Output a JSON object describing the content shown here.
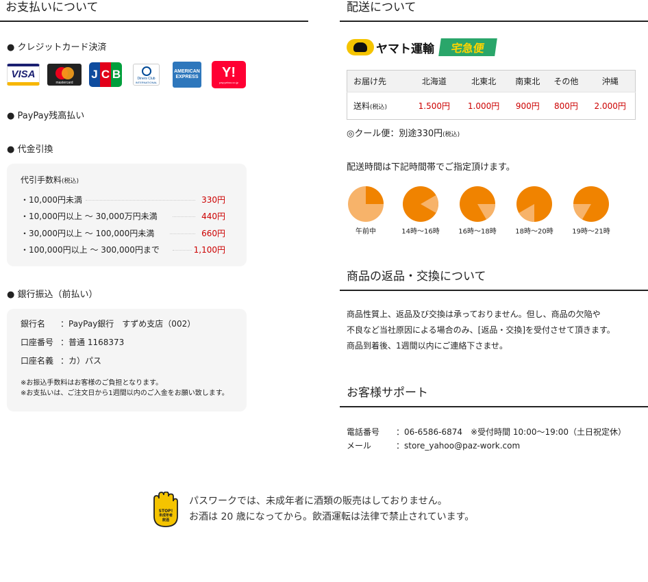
{
  "payment": {
    "title": "お支払いについて",
    "credit_card": "● クレジットカード決済",
    "cards": {
      "visa": "VISA",
      "mastercard": "mastercard",
      "jcb": [
        "J",
        "C",
        "B"
      ],
      "diners": "Diners Club",
      "diners_sub": "INTERNATIONAL",
      "amex_1": "AMERICAN",
      "amex_2": "EXPRESS",
      "yahoo": "Y!",
      "yahoo_sub": "pay.yahoo.co.jp"
    },
    "paypay": "● PayPay残高払い",
    "cod": "● 代金引換",
    "cod_fee_title": "代引手数料",
    "cod_fee_tax": "(税込)",
    "cod_fees": [
      {
        "label": "・10,000円未満",
        "amount": "330円"
      },
      {
        "label": "・10,000円以上 ～ 30,000万円未満",
        "amount": "440円"
      },
      {
        "label": "・30,000円以上 ～ 100,000円未満",
        "amount": "660円"
      },
      {
        "label": "・100,000円以上 ～ 300,000円まで",
        "amount": "1,100円"
      }
    ],
    "bank": "● 銀行振込（前払い）",
    "bank_rows": [
      {
        "label": "銀行名",
        "value": "：PayPay銀行　すずめ支店（002）"
      },
      {
        "label": "口座番号",
        "value": "：普通  1168373"
      },
      {
        "label": "口座名義",
        "value": "：カ）パス"
      }
    ],
    "bank_notes": [
      "※お振込手数料はお客様のご負担となります。",
      "※お支払いは、ご注文日から1週間以内のご入金をお願い致します。"
    ]
  },
  "shipping": {
    "title": "配送について",
    "carrier": "ヤマト運輸",
    "service": "宅急便",
    "table_headers": [
      "お届け先",
      "北海道",
      "北東北",
      "南東北",
      "その他",
      "沖縄"
    ],
    "row_label": "送料",
    "row_label_tax": "(税込)",
    "row_values": [
      "1.500円",
      "1.000円",
      "900円",
      "800円",
      "2.000円"
    ],
    "cool": "◎クール便：別途330円",
    "cool_tax": "(税込)",
    "time_note": "配送時間は下記時間帯でご指定頂けます。",
    "time_slots": [
      "午前中",
      "14時～16時",
      "16時～18時",
      "18時～20時",
      "19時～21時"
    ]
  },
  "returns": {
    "title": "商品の返品・交換について",
    "lines": [
      "商品性質上、返品及び交換は承っておりません。但し、商品の欠陥や",
      "不良など当社原因による場合のみ、[返品・交換]を受付させて頂きます。",
      "商品到着後、1週間以内にご連絡下さませ。"
    ]
  },
  "support": {
    "title": "お客様サポート",
    "phone_label": "電話番号",
    "phone_value": "：06-6586-6874　※受付時間 10:00～19:00（土日祝定休）",
    "mail_label": "メール",
    "mail_value": "：store_yahoo@paz-work.com"
  },
  "notice": {
    "stop": "STOP!",
    "stop_sub": "未成年者",
    "stop_sub2": "飲酒",
    "line1": "パスワークでは、未成年者に酒類の販売はしておりません。",
    "line2": "お酒は 20 歳になってから。飲酒運転は法律で禁止されています。"
  },
  "colors": {
    "price": "#cc0000",
    "clock": "#f08300",
    "clock_light": "#f7b36a",
    "yamato_green": "#2aa66a"
  }
}
